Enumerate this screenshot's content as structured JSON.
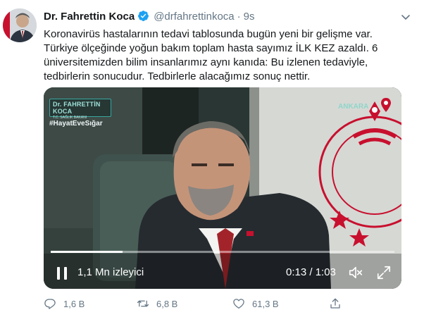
{
  "tweet": {
    "author_name": "Dr. Fahrettin Koca",
    "handle": "@drfahrettinkoca",
    "separator": "·",
    "time": "9s",
    "text": "Koronavirüs hastalarının tedavi tablosunda bugün yeni bir gelişme var. Türkiye ölçeğinde yoğun bakım toplam hasta sayımız İLK KEZ azaldı. 6 üniversitemizden bilim insanlarımız aynı kanıda: Bu izlenen tedaviyle, tedbirlerin sonucudur. Tedbirlerle alacağımız sonuç nettir.",
    "verified_icon": "verified-badge-icon",
    "accent_color": "#1da1f2"
  },
  "video": {
    "brand_name": "Dr. FAHRETTİN KOCA",
    "brand_subtitle": "T.C. SAĞLIK BAKANI",
    "hashtag": "#HayatEveSığar",
    "location": "ANKARA",
    "views": "1,1 Mn izleyici",
    "timecode": "0:13 / 1:03",
    "progress": 0.21,
    "seal_color": "#c8102e",
    "state": "playing"
  },
  "actions": {
    "replies": "1,6 B",
    "retweets": "6,8 B",
    "likes": "61,3 B"
  }
}
